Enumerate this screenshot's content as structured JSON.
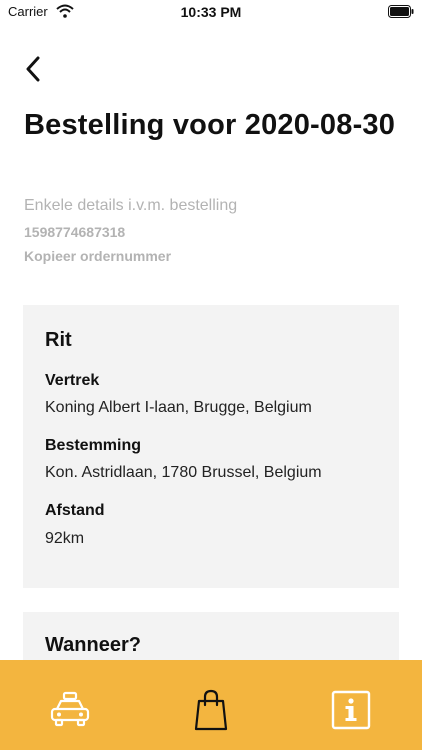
{
  "status_bar": {
    "carrier": "Carrier",
    "time": "10:33 PM"
  },
  "header": {
    "title": "Bestelling voor 2020-08-30",
    "subtitle": "Enkele details i.v.m. bestelling",
    "order_number": "1598774687318",
    "copy_label": "Kopieer ordernummer"
  },
  "ride_card": {
    "heading": "Rit",
    "departure_label": "Vertrek",
    "departure_value": "Koning Albert I-laan, Brugge, Belgium",
    "destination_label": "Bestemming",
    "destination_value": "Kon. Astridlaan, 1780 Brussel, Belgium",
    "distance_label": "Afstand",
    "distance_value": "92km"
  },
  "when_card": {
    "heading": "Wanneer?"
  },
  "tab_bar": {
    "tabs": [
      "taxi-icon",
      "shopping-bag-icon",
      "info-icon"
    ],
    "active_tab": "shopping-bag-icon"
  },
  "colors": {
    "accent": "#f3b53f",
    "card_background": "#f3f3f3",
    "muted_text": "#b3b3b3"
  }
}
